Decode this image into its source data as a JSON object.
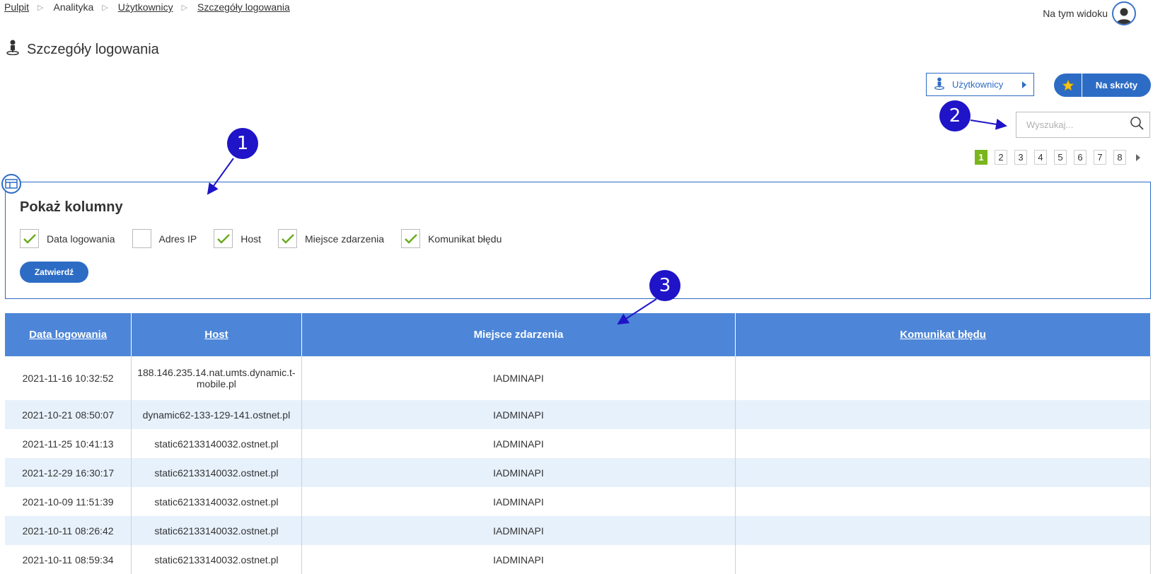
{
  "breadcrumb": {
    "items": [
      {
        "label": "Pulpit",
        "link": true
      },
      {
        "label": "Analityka",
        "link": false
      },
      {
        "label": "Użytkownicy",
        "link": true
      },
      {
        "label": "Szczegóły logowania",
        "link": true
      }
    ]
  },
  "view_mode": {
    "label": "Na tym widoku"
  },
  "page": {
    "title": "Szczegóły logowania"
  },
  "toolbar": {
    "users_button": "Użytkownicy",
    "shortcuts_button": "Na skróty"
  },
  "search": {
    "placeholder": "Wyszukaj...",
    "value": ""
  },
  "pagination": {
    "pages": [
      "1",
      "2",
      "3",
      "4",
      "5",
      "6",
      "7",
      "8"
    ],
    "current": "1"
  },
  "columns_panel": {
    "title": "Pokaż kolumny",
    "options": [
      {
        "label": "Data logowania",
        "checked": true
      },
      {
        "label": "Adres IP",
        "checked": false
      },
      {
        "label": "Host",
        "checked": true
      },
      {
        "label": "Miejsce zdarzenia",
        "checked": true
      },
      {
        "label": "Komunikat błędu",
        "checked": true
      }
    ],
    "submit_label": "Zatwierdź"
  },
  "table": {
    "headers": [
      "Data logowania",
      "Host",
      "Miejsce zdarzenia",
      "Komunikat błędu"
    ],
    "rows": [
      [
        "2021-11-16 10:32:52",
        "188.146.235.14.nat.umts.dynamic.t-mobile.pl",
        "IADMINAPI",
        ""
      ],
      [
        "2021-10-21 08:50:07",
        "dynamic62-133-129-141.ostnet.pl",
        "IADMINAPI",
        ""
      ],
      [
        "2021-11-25 10:41:13",
        "static62133140032.ostnet.pl",
        "IADMINAPI",
        ""
      ],
      [
        "2021-12-29 16:30:17",
        "static62133140032.ostnet.pl",
        "IADMINAPI",
        ""
      ],
      [
        "2021-10-09 11:51:39",
        "static62133140032.ostnet.pl",
        "IADMINAPI",
        ""
      ],
      [
        "2021-10-11 08:26:42",
        "static62133140032.ostnet.pl",
        "IADMINAPI",
        ""
      ],
      [
        "2021-10-11 08:59:34",
        "static62133140032.ostnet.pl",
        "IADMINAPI",
        ""
      ]
    ]
  },
  "callouts": [
    "1",
    "2",
    "3"
  ],
  "colors": {
    "accent": "#2d6cc4",
    "header_bg": "#4d86d8",
    "active_page": "#7ab51d",
    "callout": "#1f14c8",
    "row_alt": "#e7f1fc"
  }
}
